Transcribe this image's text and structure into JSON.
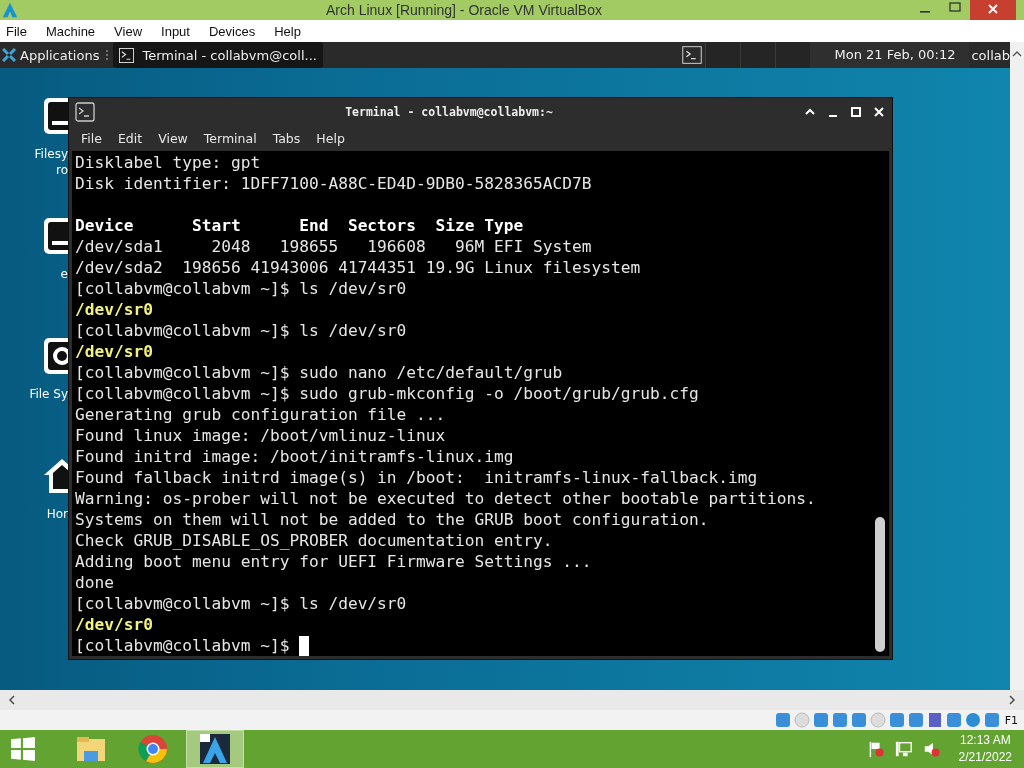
{
  "host_window": {
    "title": "Arch Linux [Running] - Oracle VM VirtualBox",
    "menu": [
      "File",
      "Machine",
      "View",
      "Input",
      "Devices",
      "Help"
    ]
  },
  "vm_panel": {
    "applications": "Applications",
    "tasks": [
      {
        "label": "Terminal - collabvm@coll...",
        "selected": true
      }
    ],
    "clock": "Mon 21 Feb, 00:12",
    "user": "collab"
  },
  "desktop_icons": [
    {
      "kind": "drive",
      "labels": [
        "Filesy",
        "ro"
      ]
    },
    {
      "kind": "drive",
      "labels": [
        "e"
      ]
    },
    {
      "kind": "camera",
      "labels": [
        "File Sy"
      ]
    },
    {
      "kind": "home",
      "labels": [
        "Hor"
      ]
    }
  ],
  "terminal": {
    "title": "Terminal - collabvm@collabvm:~",
    "menu": [
      "File",
      "Edit",
      "View",
      "Terminal",
      "Tabs",
      "Help"
    ],
    "lines": [
      {
        "kind": "normal",
        "text": "Disklabel type: gpt"
      },
      {
        "kind": "normal",
        "text": "Disk identifier: 1DFF7100-A88C-ED4D-9DB0-5828365ACD7B"
      },
      {
        "kind": "blank"
      },
      {
        "kind": "bold",
        "text": "Device      Start      End  Sectors  Size Type"
      },
      {
        "kind": "normal",
        "text": "/dev/sda1     2048   198655   196608   96M EFI System"
      },
      {
        "kind": "normal",
        "text": "/dev/sda2  198656 41943006 41744351 19.9G Linux filesystem"
      },
      {
        "kind": "normal",
        "text": "[collabvm@collabvm ~]$ ls /dev/sr0"
      },
      {
        "kind": "yellow",
        "text": "/dev/sr0"
      },
      {
        "kind": "normal",
        "text": "[collabvm@collabvm ~]$ ls /dev/sr0"
      },
      {
        "kind": "yellow",
        "text": "/dev/sr0"
      },
      {
        "kind": "normal",
        "text": "[collabvm@collabvm ~]$ sudo nano /etc/default/grub"
      },
      {
        "kind": "normal",
        "text": "[collabvm@collabvm ~]$ sudo grub-mkconfig -o /boot/grub/grub.cfg"
      },
      {
        "kind": "normal",
        "text": "Generating grub configuration file ..."
      },
      {
        "kind": "normal",
        "text": "Found linux image: /boot/vmlinuz-linux"
      },
      {
        "kind": "normal",
        "text": "Found initrd image: /boot/initramfs-linux.img"
      },
      {
        "kind": "normal",
        "text": "Found fallback initrd image(s) in /boot:  initramfs-linux-fallback.img"
      },
      {
        "kind": "normal",
        "text": "Warning: os-prober will not be executed to detect other bootable partitions."
      },
      {
        "kind": "normal",
        "text": "Systems on them will not be added to the GRUB boot configuration."
      },
      {
        "kind": "normal",
        "text": "Check GRUB_DISABLE_OS_PROBER documentation entry."
      },
      {
        "kind": "normal",
        "text": "Adding boot menu entry for UEFI Firmware Settings ..."
      },
      {
        "kind": "normal",
        "text": "done"
      },
      {
        "kind": "normal",
        "text": "[collabvm@collabvm ~]$ ls /dev/sr0"
      },
      {
        "kind": "yellow",
        "text": "/dev/sr0"
      },
      {
        "kind": "prompt",
        "text": "[collabvm@collabvm ~]$ "
      }
    ]
  },
  "status_bar": {
    "host_key": "F1"
  },
  "taskbar": {
    "apps": [
      {
        "kind": "folder",
        "selected": false
      },
      {
        "kind": "browser",
        "selected": false
      },
      {
        "kind": "arch",
        "selected": true
      }
    ],
    "time": "12:13 AM",
    "date": "2/21/2022"
  }
}
